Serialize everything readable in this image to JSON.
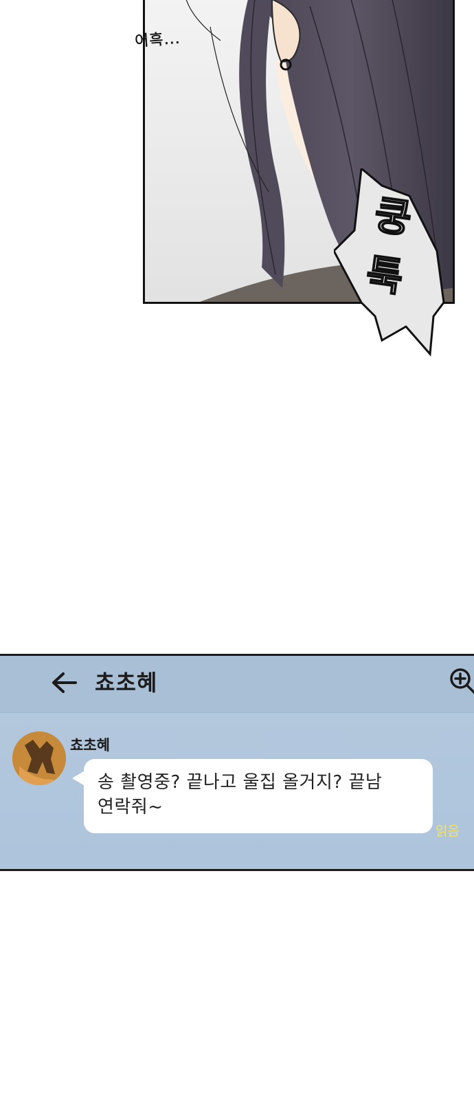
{
  "panel": {
    "sfx_small": "어흑...",
    "sfx_big": "쿵툭"
  },
  "chat": {
    "room_title": "쵸초혜",
    "sender_name": "쵸초혜",
    "message_lines": [
      "송 촬영중? 끝나고 울집 올거지? 끝남",
      "연락줘~"
    ],
    "read_status": "읽음",
    "icons": {
      "back": "arrow-left-icon",
      "zoom": "zoom-in-icon"
    },
    "colors": {
      "background": "#b0c6dd",
      "bubble": "#ffffff",
      "read_status": "#f3e36a"
    }
  }
}
